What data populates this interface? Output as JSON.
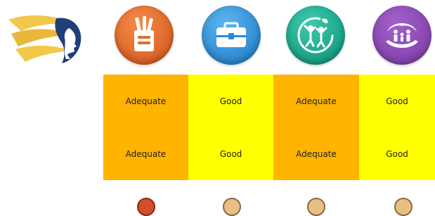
{
  "colors": {
    "orange_cell": "#ffb400",
    "yellow_cell": "#ffff00",
    "dot_active": "#d24f2b",
    "dot_inactive": "#e9bf85"
  },
  "icons": [
    {
      "name": "stationery-cup-icon",
      "color": "#e46c2a"
    },
    {
      "name": "briefcase-icon",
      "color": "#2a8ad8"
    },
    {
      "name": "jumping-people-icon",
      "color": "#11a88a"
    },
    {
      "name": "family-hands-icon",
      "color": "#8e4db8"
    }
  ],
  "grid": {
    "rows": [
      [
        "Adequate",
        "Good",
        "Adequate",
        "Good"
      ],
      [
        "Adequate",
        "Good",
        "Adequate",
        "Good"
      ]
    ]
  },
  "pagination": {
    "count": 4,
    "active_index": 0
  }
}
